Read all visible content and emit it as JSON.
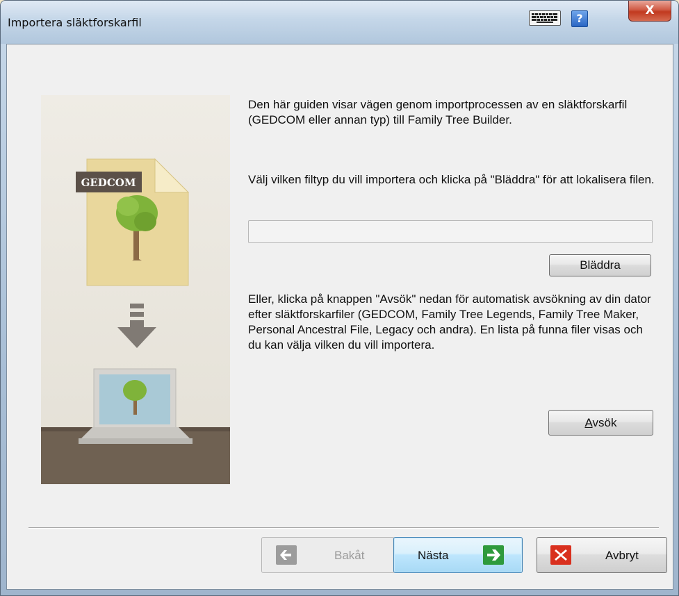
{
  "window": {
    "title": "Importera släktforskarfil",
    "icons": [
      "keyboard-icon",
      "help-icon",
      "close-icon"
    ],
    "help_glyph": "?",
    "close_glyph": "X"
  },
  "illustration": {
    "file_label": "GEDCOM"
  },
  "content": {
    "intro": "Den här guiden visar vägen genom importprocessen av en släktforskarfil (GEDCOM eller annan typ) till Family Tree Builder.",
    "instruction": "Välj vilken filtyp du vill importera och klicka på \"Bläddra\" för att lokalisera filen.",
    "file_path_value": "",
    "browse_label": "Bläddra",
    "scan_text": "Eller, klicka på knappen \"Avsök\" nedan för automatisk avsökning av din dator efter släktforskarfiler (GEDCOM, Family Tree Legends, Family Tree Maker, Personal Ancestral File, Legacy och andra). En lista på funna filer visas och du kan välja vilken du vill importera.",
    "scan_label_accel": "A",
    "scan_label_rest": "vsök"
  },
  "footer": {
    "back_label": "Bakåt",
    "next_label": "Nästa",
    "cancel_label": "Avbryt"
  },
  "colors": {
    "next_icon": "#2e9a3c",
    "cancel_icon": "#d9301e",
    "back_icon": "#9c9c9c"
  }
}
